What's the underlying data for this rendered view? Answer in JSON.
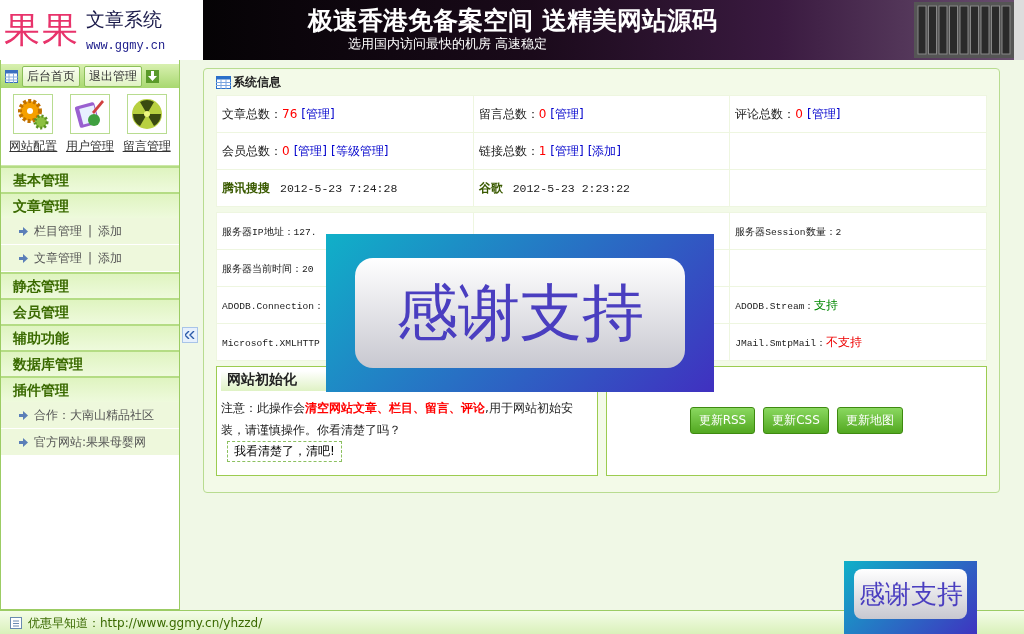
{
  "logo": {
    "brand": "果果",
    "title": "文章系统",
    "url": "www.ggmy.cn"
  },
  "banner": {
    "headline": "极速香港免备案空间 送精美网站源码",
    "subline": "选用国内访问最快的机房 高速稳定"
  },
  "sidebar": {
    "top_buttons": [
      "后台首页",
      "退出管理"
    ],
    "shortcuts": [
      {
        "label": "网站配置",
        "kind": "gear"
      },
      {
        "label": "用户管理",
        "kind": "notebook"
      },
      {
        "label": "留言管理",
        "kind": "radiation"
      }
    ],
    "menu": [
      {
        "title": "基本管理"
      },
      {
        "title": "文章管理",
        "children": [
          {
            "label": "栏目管理",
            "separator": "|",
            "extra": "添加"
          },
          {
            "label": "文章管理",
            "separator": "|",
            "extra": "添加"
          }
        ]
      },
      {
        "title": "静态管理"
      },
      {
        "title": "会员管理"
      },
      {
        "title": "辅助功能"
      },
      {
        "title": "数据库管理"
      },
      {
        "title": "插件管理",
        "children": [
          {
            "label": "合作：大南山精品社区"
          },
          {
            "label": "官方网站:果果母婴网"
          }
        ]
      }
    ]
  },
  "system_info": {
    "title": "系统信息",
    "stats": [
      [
        {
          "kind": "count",
          "label": "文章总数：",
          "value": "76",
          "links": [
            "[管理]"
          ]
        },
        {
          "kind": "count",
          "label": "留言总数：",
          "value": "0",
          "links": [
            "[管理]"
          ]
        },
        {
          "kind": "count",
          "label": "评论总数：",
          "value": "0",
          "links": [
            "[管理]"
          ]
        }
      ],
      [
        {
          "kind": "count",
          "label": "会员总数：",
          "value": "0",
          "links": [
            "[管理]",
            "[等级管理]"
          ]
        },
        {
          "kind": "count",
          "label": "链接总数：",
          "value": "1",
          "links": [
            "[管理]",
            "[添加]"
          ]
        },
        {
          "kind": "empty"
        }
      ],
      [
        {
          "kind": "time",
          "label": "腾讯搜搜",
          "value": "2012-5-23 7:24:28"
        },
        {
          "kind": "time",
          "label": "谷歌",
          "value": "2012-5-23 2:23:22"
        },
        {
          "kind": "empty"
        }
      ]
    ],
    "server": [
      [
        {
          "kind": "text",
          "text": "服务器IP地址：127."
        },
        {
          "kind": "empty"
        },
        {
          "kind": "text",
          "text": "服务器Session数量：2"
        }
      ],
      [
        {
          "kind": "text",
          "text": "服务器当前时间：20"
        },
        {
          "kind": "empty"
        },
        {
          "kind": "empty"
        }
      ],
      [
        {
          "kind": "text",
          "text": "ADODB.Connection："
        },
        {
          "kind": "empty"
        },
        {
          "kind": "component",
          "text": "ADODB.Stream：",
          "status": "支持",
          "supported": true
        }
      ],
      [
        {
          "kind": "text",
          "text": "Microsoft.XMLHTTP"
        },
        {
          "kind": "empty"
        },
        {
          "kind": "component",
          "text": "JMail.SmtpMail：",
          "status": "不支持",
          "supported": false
        }
      ]
    ]
  },
  "init_panel": {
    "title": "网站初始化",
    "notice": "注意：此操作会**清空网站文章、栏目、留言、评论**,用于网站初始安装，请谨慎操作。你看清楚了吗？",
    "button": "我看清楚了，清吧!"
  },
  "update_panel": {
    "buttons": [
      "更新RSS",
      "更新CSS",
      "更新地图"
    ]
  },
  "popups": [
    {
      "text": "感谢支持"
    },
    {
      "text": "感谢支持"
    }
  ],
  "status_bar": {
    "text": "优惠早知道：http://www.ggmy.cn/yhzzd/"
  }
}
